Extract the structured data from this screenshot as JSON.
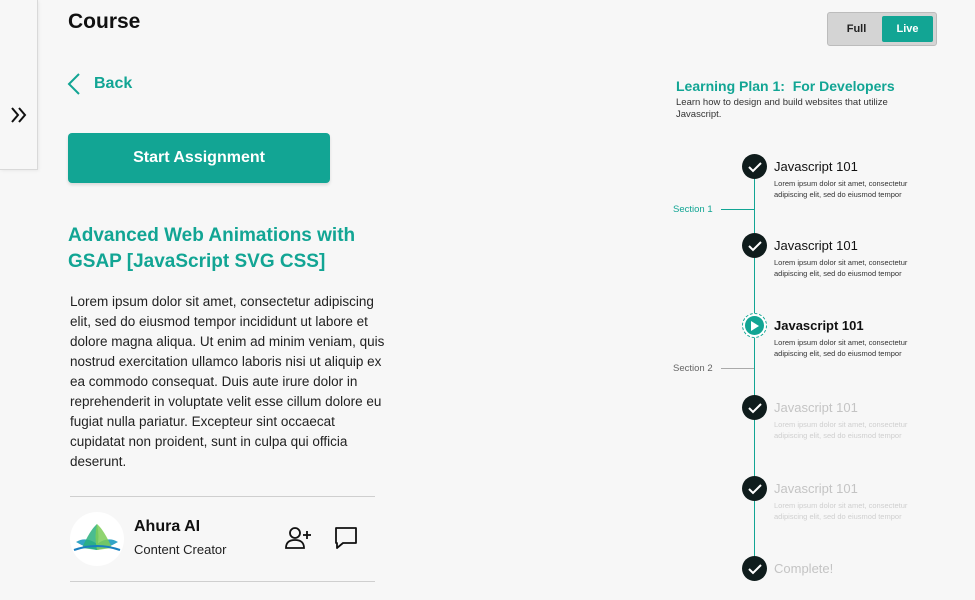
{
  "page": {
    "title": "Course"
  },
  "nav": {
    "back_label": "Back",
    "expand_icon": "double-chevron-right-icon"
  },
  "actions": {
    "start_label": "Start Assignment"
  },
  "course": {
    "title": "Advanced Web Animations with GSAP [JavaScript SVG CSS]",
    "description": "Lorem ipsum dolor sit amet, consectetur adipiscing elit, sed do eiusmod tempor incididunt ut labore et dolore magna aliqua. Ut enim ad minim veniam, quis nostrud exercitation ullamco laboris nisi ut aliquip ex ea commodo consequat. Duis aute irure dolor in reprehenderit in voluptate velit esse cillum dolore eu fugiat nulla pariatur. Excepteur sint occaecat cupidatat non proident, sunt in culpa qui officia deserunt."
  },
  "author": {
    "name": "Ahura AI",
    "role": "Content Creator"
  },
  "view_toggle": {
    "options": [
      "Full",
      "Live"
    ],
    "selected": "Live"
  },
  "plan": {
    "title": "Learning Plan 1:  For Developers",
    "description": "Learn how to design and build websites that utilize Javascript.",
    "sections": [
      {
        "label": "Section 1"
      },
      {
        "label": "Section 2"
      }
    ],
    "steps": [
      {
        "title": "Javascript 101",
        "description": "Lorem ipsum dolor sit amet, consectetur adipiscing elit, sed do eiusmod tempor",
        "status": "complete"
      },
      {
        "title": "Javascript 101",
        "description": "Lorem ipsum dolor sit amet, consectetur adipiscing elit, sed do eiusmod tempor",
        "status": "complete"
      },
      {
        "title": "Javascript 101",
        "description": "Lorem ipsum dolor sit amet, consectetur adipiscing elit, sed do eiusmod tempor",
        "status": "current"
      },
      {
        "title": "Javascript 101",
        "description": "Lorem ipsum dolor sit amet, consectetur adipiscing elit, sed do eiusmod tempor",
        "status": "locked"
      },
      {
        "title": "Javascript 101",
        "description": "Lorem ipsum dolor sit amet, consectetur adipiscing elit, sed do eiusmod tempor",
        "status": "locked"
      },
      {
        "title": "Complete!",
        "description": "",
        "status": "locked"
      }
    ]
  },
  "colors": {
    "accent": "#12a594",
    "node_dark": "#0f1c1c",
    "faded_text": "#c4c4c4"
  }
}
